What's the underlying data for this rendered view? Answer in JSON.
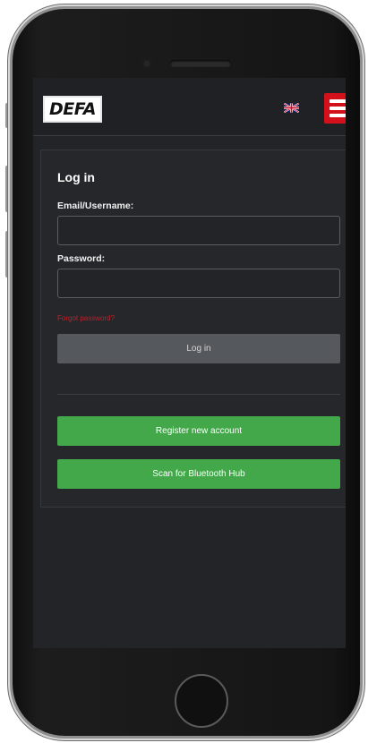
{
  "header": {
    "logo_text": "DEFA",
    "language_flag": "uk-flag-icon",
    "menu_icon": "hamburger-menu-icon",
    "menu_color": "#d3111b"
  },
  "login": {
    "title": "Log in",
    "email_label": "Email/Username:",
    "email_value": "",
    "password_label": "Password:",
    "password_value": "",
    "forgot_label": "Forgot password?",
    "login_button": "Log in"
  },
  "actions": {
    "register_button": "Register new account",
    "scan_button": "Scan for Bluetooth Hub",
    "accent_color": "#42a84a"
  }
}
